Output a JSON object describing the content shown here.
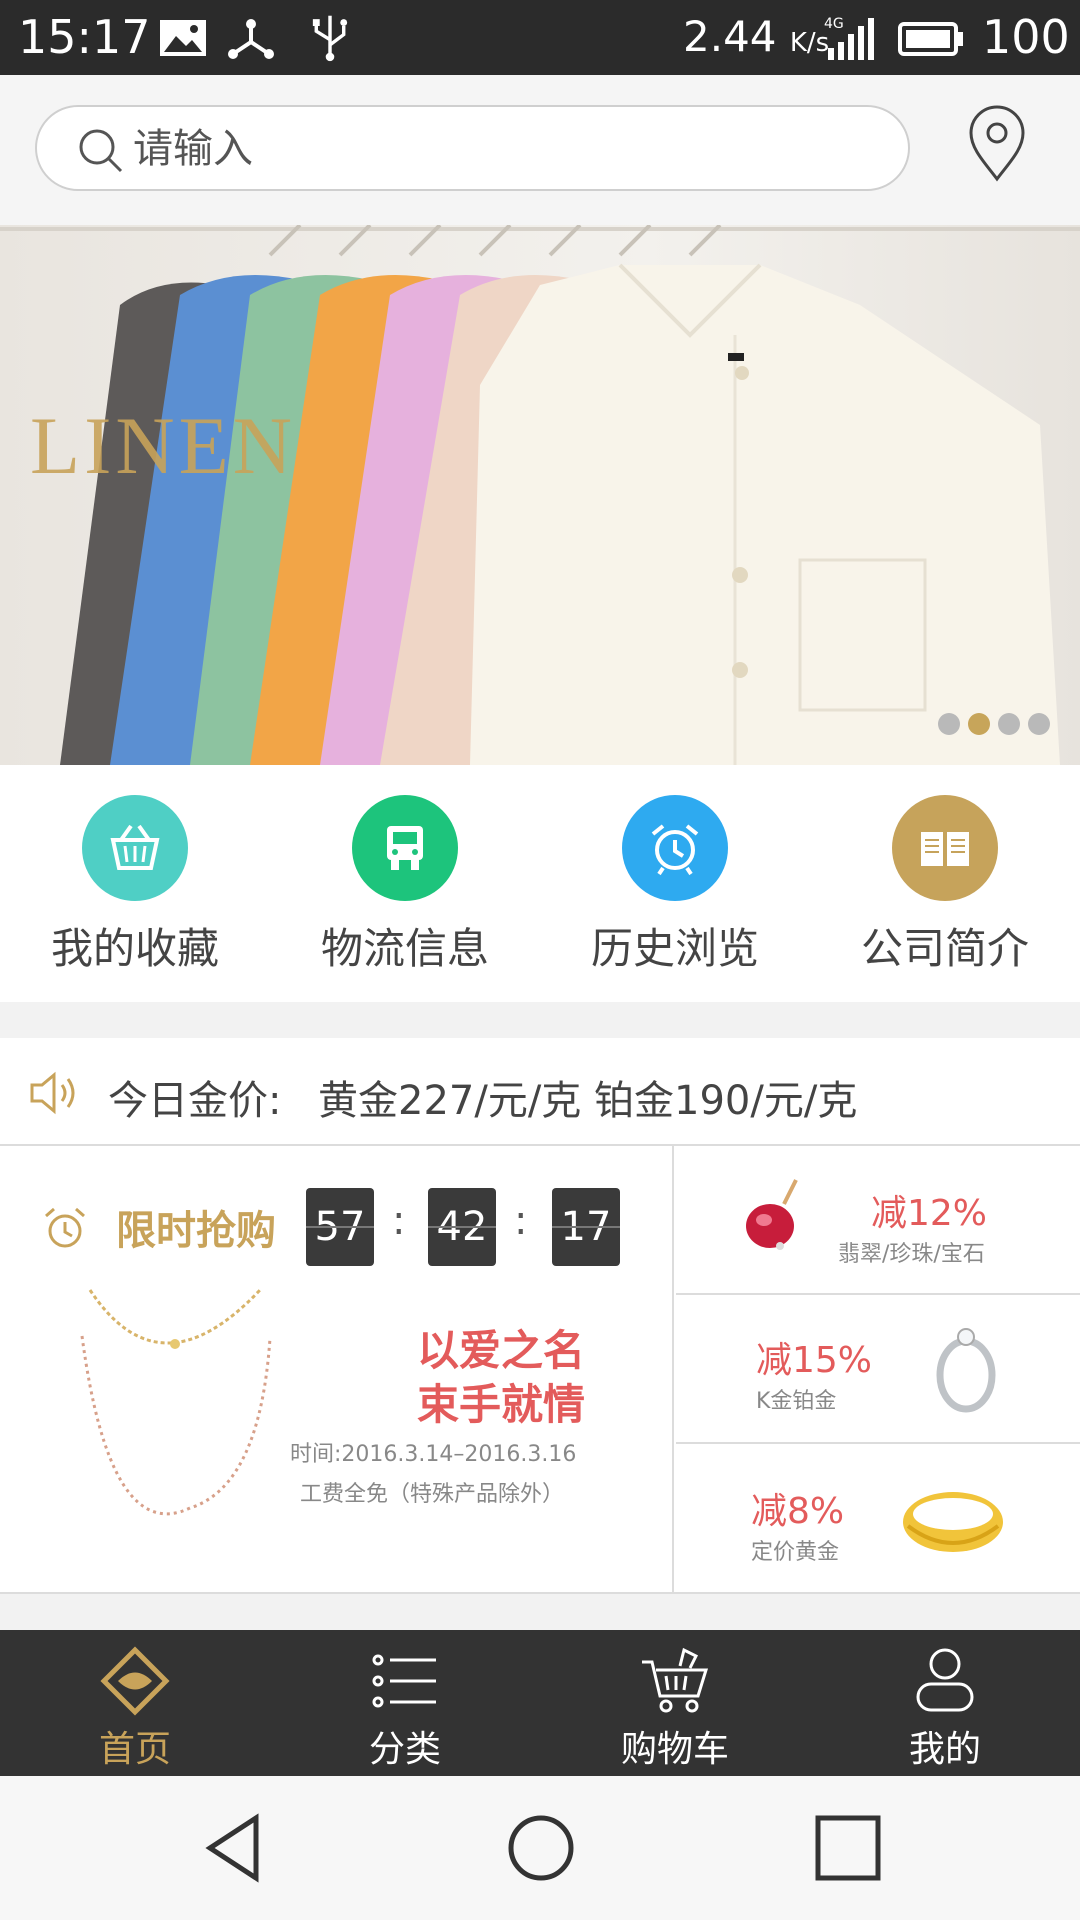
{
  "status_bar": {
    "time": "15:17",
    "net_speed": "2.44",
    "net_unit": "K/s",
    "battery": "100",
    "icons": [
      "image-icon",
      "share-icon",
      "usb-icon",
      "signal-icon",
      "battery-icon"
    ]
  },
  "search": {
    "placeholder": "请输入",
    "icon": "search-icon",
    "location_icon": "location-pin-icon"
  },
  "banner": {
    "brand_text": "LINEN",
    "dots": 4,
    "active_dot": 2
  },
  "shortcuts": [
    {
      "label": "我的收藏",
      "icon": "basket-icon",
      "color": "#4fcfc5"
    },
    {
      "label": "物流信息",
      "icon": "truck-icon",
      "color": "#1dc47c"
    },
    {
      "label": "历史浏览",
      "icon": "alarm-clock-icon",
      "color": "#2eaaf0"
    },
    {
      "label": "公司简介",
      "icon": "book-icon",
      "color": "#c6a35b"
    }
  ],
  "notice": {
    "prefix": "今日金价:",
    "text": "黄金227/元/克 铂金190/元/克"
  },
  "flash_sale": {
    "title": "限时抢购",
    "hours": "57",
    "minutes": "42",
    "seconds": "17",
    "headline_line1": "以爱之名",
    "headline_line2": "束手就情",
    "date": "时间:2016.3.14–2016.3.16",
    "note": "工费全免（特殊产品除外）"
  },
  "deals": [
    {
      "percent": "减12%",
      "subtitle": "翡翠/珍珠/宝石"
    },
    {
      "percent": "减15%",
      "subtitle": "K金铂金"
    },
    {
      "percent": "减8%",
      "subtitle": "定价黄金"
    }
  ],
  "bottom_nav": [
    {
      "label": "首页",
      "active": true
    },
    {
      "label": "分类",
      "active": false
    },
    {
      "label": "购物车",
      "active": false
    },
    {
      "label": "我的",
      "active": false
    }
  ],
  "colors": {
    "gold": "#c8a35a",
    "red": "#e35b5b",
    "dark": "#333333"
  }
}
